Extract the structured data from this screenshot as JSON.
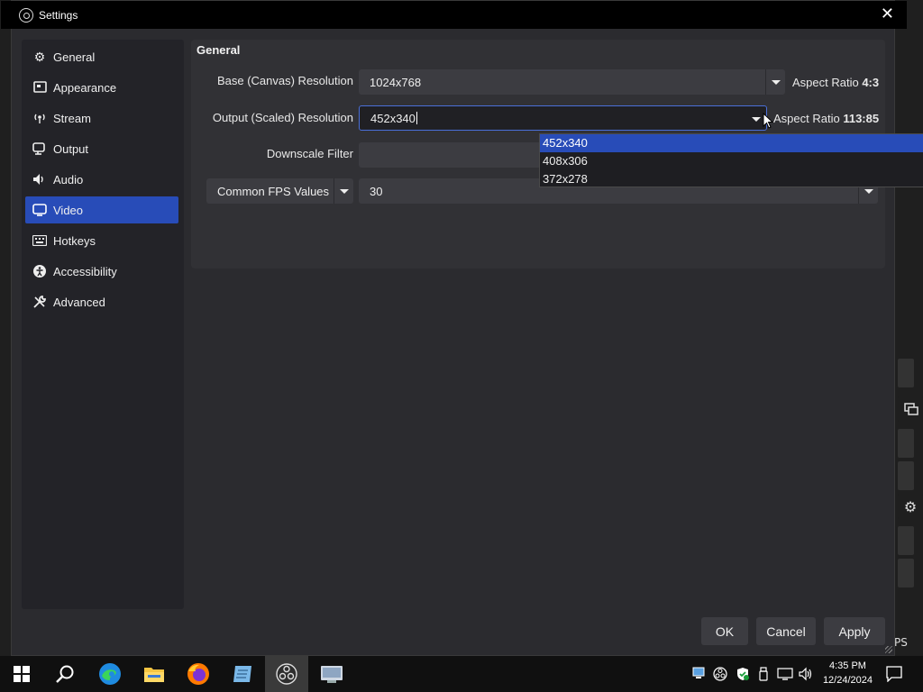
{
  "window": {
    "title": "Settings"
  },
  "sidebar": {
    "items": [
      {
        "label": "General",
        "icon": "gear-icon"
      },
      {
        "label": "Appearance",
        "icon": "appearance-icon"
      },
      {
        "label": "Stream",
        "icon": "stream-icon"
      },
      {
        "label": "Output",
        "icon": "output-icon"
      },
      {
        "label": "Audio",
        "icon": "audio-icon"
      },
      {
        "label": "Video",
        "icon": "video-icon",
        "active": true
      },
      {
        "label": "Hotkeys",
        "icon": "keyboard-icon"
      },
      {
        "label": "Accessibility",
        "icon": "accessibility-icon"
      },
      {
        "label": "Advanced",
        "icon": "wrench-icon"
      }
    ]
  },
  "video": {
    "section_title": "General",
    "base_label": "Base (Canvas) Resolution",
    "base_value": "1024x768",
    "base_aspect_label": "Aspect Ratio",
    "base_aspect_value": "4:3",
    "output_label": "Output (Scaled) Resolution",
    "output_value": "452x340",
    "output_aspect_label": "Aspect Ratio",
    "output_aspect_value": "113:85",
    "downscale_label": "Downscale Filter",
    "fps_type": "Common FPS Values",
    "fps_value": "30",
    "dropdown_options": [
      "452x340",
      "408x306",
      "372x278"
    ],
    "dropdown_selected": "452x340"
  },
  "buttons": {
    "ok": "OK",
    "cancel": "Cancel",
    "apply": "Apply"
  },
  "background": {
    "fps_fragment": "PS"
  },
  "taskbar": {
    "time": "4:35 PM",
    "date": "12/24/2024",
    "apps": [
      "start-icon",
      "search-icon",
      "edge-icon",
      "file-explorer-icon",
      "firefox-icon",
      "notepad-icon",
      "obs-icon",
      "app-icon"
    ]
  },
  "colors": {
    "accent": "#284cb8",
    "panel": "#313135",
    "dialog": "#2b2b2f"
  }
}
